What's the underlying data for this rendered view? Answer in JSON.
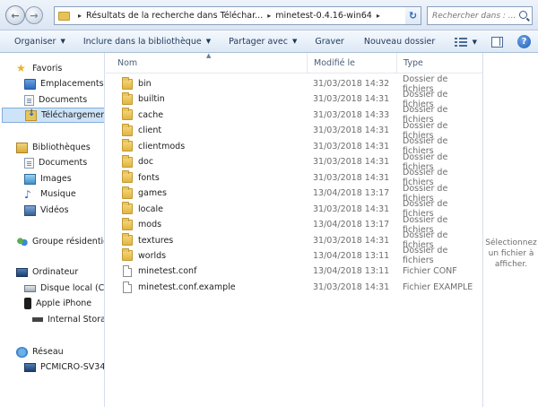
{
  "address": {
    "crumbs": [
      "Résultats de la recherche dans Téléchar...",
      "minetest-0.4.16-win64"
    ],
    "search_placeholder": "Rechercher dans : ..."
  },
  "toolbar": {
    "organize": "Organiser",
    "include": "Inclure dans la bibliothèque",
    "share": "Partager avec",
    "burn": "Graver",
    "new_folder": "Nouveau dossier"
  },
  "nav": {
    "favorites": {
      "label": "Favoris",
      "items": [
        "Emplacements r",
        "Documents",
        "Téléchargements"
      ]
    },
    "libraries": {
      "label": "Bibliothèques",
      "items": [
        "Documents",
        "Images",
        "Musique",
        "Vidéos"
      ]
    },
    "homegroup": "Groupe résidentie",
    "computer": {
      "label": "Ordinateur",
      "items": [
        "Disque local (C:)",
        "Apple iPhone",
        "Internal Storag"
      ]
    },
    "network": {
      "label": "Réseau",
      "items": [
        "PCMICRO-SV34"
      ]
    }
  },
  "columns": {
    "name": "Nom",
    "date": "Modifié le",
    "type": "Type"
  },
  "files": [
    {
      "name": "bin",
      "date": "31/03/2018 14:32",
      "type": "Dossier de fichiers",
      "kind": "folder"
    },
    {
      "name": "builtin",
      "date": "31/03/2018 14:31",
      "type": "Dossier de fichiers",
      "kind": "folder"
    },
    {
      "name": "cache",
      "date": "31/03/2018 14:33",
      "type": "Dossier de fichiers",
      "kind": "folder"
    },
    {
      "name": "client",
      "date": "31/03/2018 14:31",
      "type": "Dossier de fichiers",
      "kind": "folder"
    },
    {
      "name": "clientmods",
      "date": "31/03/2018 14:31",
      "type": "Dossier de fichiers",
      "kind": "folder"
    },
    {
      "name": "doc",
      "date": "31/03/2018 14:31",
      "type": "Dossier de fichiers",
      "kind": "folder"
    },
    {
      "name": "fonts",
      "date": "31/03/2018 14:31",
      "type": "Dossier de fichiers",
      "kind": "folder"
    },
    {
      "name": "games",
      "date": "13/04/2018 13:17",
      "type": "Dossier de fichiers",
      "kind": "folder"
    },
    {
      "name": "locale",
      "date": "31/03/2018 14:31",
      "type": "Dossier de fichiers",
      "kind": "folder"
    },
    {
      "name": "mods",
      "date": "13/04/2018 13:17",
      "type": "Dossier de fichiers",
      "kind": "folder"
    },
    {
      "name": "textures",
      "date": "31/03/2018 14:31",
      "type": "Dossier de fichiers",
      "kind": "folder"
    },
    {
      "name": "worlds",
      "date": "13/04/2018 13:11",
      "type": "Dossier de fichiers",
      "kind": "folder"
    },
    {
      "name": "minetest.conf",
      "date": "13/04/2018 13:11",
      "type": "Fichier CONF",
      "kind": "file"
    },
    {
      "name": "minetest.conf.example",
      "date": "31/03/2018 14:31",
      "type": "Fichier EXAMPLE",
      "kind": "file"
    }
  ],
  "preview": {
    "lines": [
      "Sélectionnez",
      "un fichier à",
      "afficher."
    ]
  }
}
